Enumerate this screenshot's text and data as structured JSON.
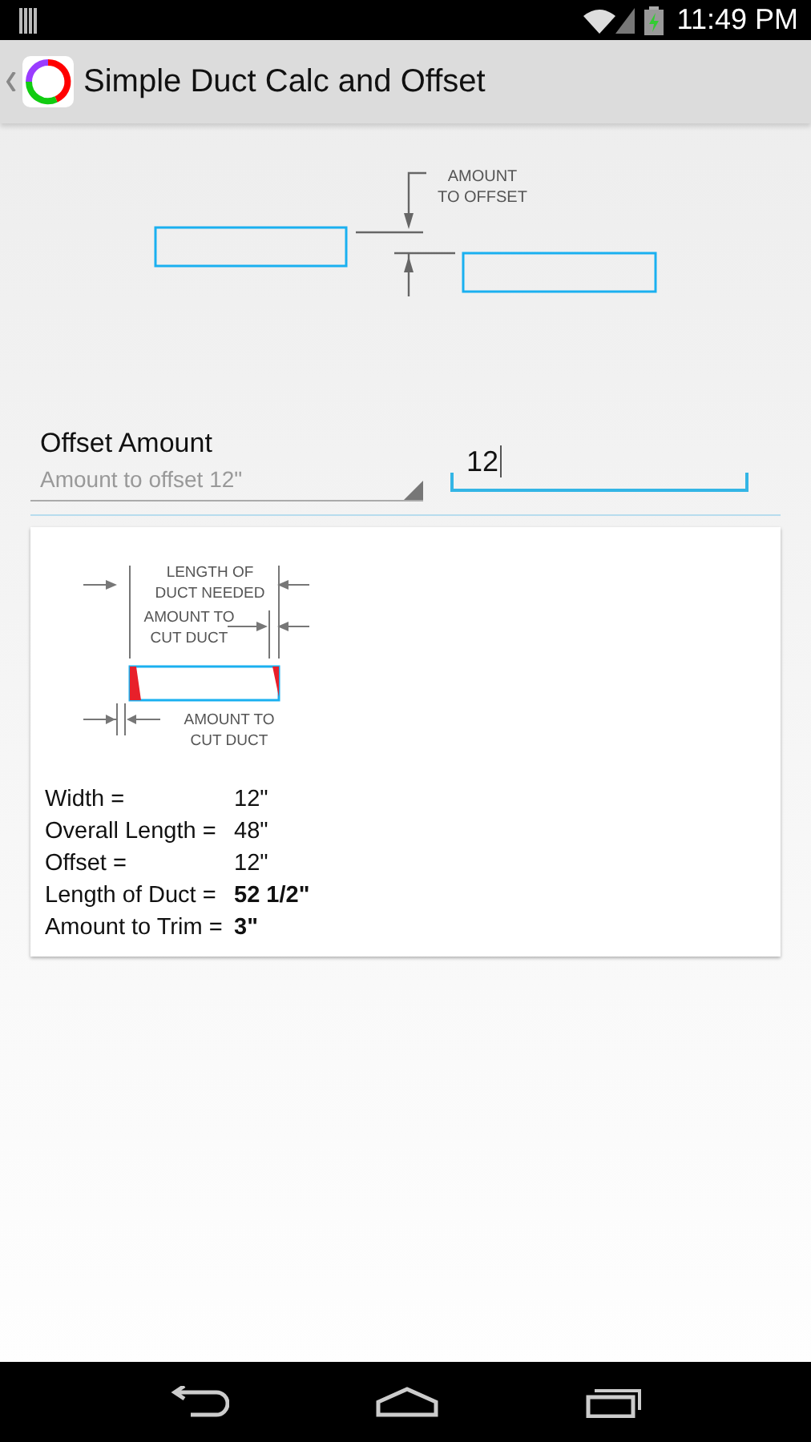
{
  "status_bar": {
    "time": "11:49 PM"
  },
  "action_bar": {
    "title": "Simple Duct Calc and Offset"
  },
  "offset_diagram": {
    "label_lines": [
      "AMOUNT",
      "TO OFFSET"
    ]
  },
  "offset_spinner": {
    "label": "Offset Amount",
    "hint": "Amount to offset 12\""
  },
  "offset_input": {
    "value": "12",
    "focused": true
  },
  "result_card": {
    "diagram": {
      "top_label": [
        "LENGTH OF",
        "DUCT NEEDED"
      ],
      "middle_label": [
        "AMOUNT TO",
        "CUT DUCT"
      ],
      "bottom_label": [
        "AMOUNT TO",
        "CUT DUCT"
      ]
    },
    "rows": [
      {
        "label": "Width =",
        "value": "12\"",
        "bold": false
      },
      {
        "label": "Overall Length =",
        "value": "48\"",
        "bold": false
      },
      {
        "label": "Offset =",
        "value": "12\"",
        "bold": false
      },
      {
        "label": "Length of Duct =",
        "value": "52 1/2\"",
        "bold": true
      },
      {
        "label": "Amount to Trim =",
        "value": "3\"",
        "bold": true
      }
    ]
  }
}
